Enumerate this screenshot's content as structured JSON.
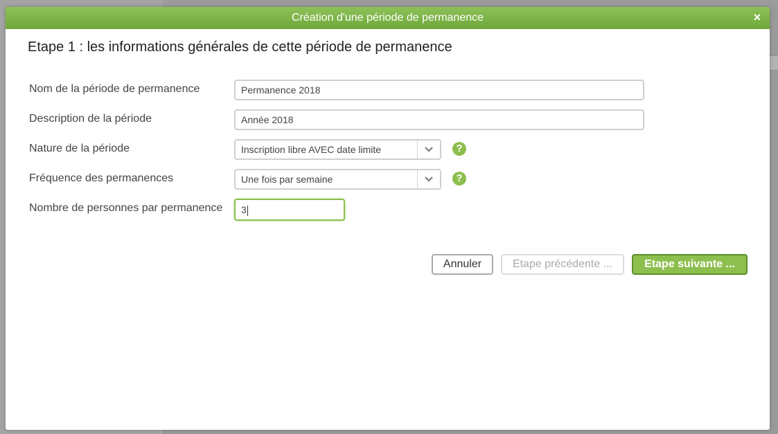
{
  "dialog": {
    "title": "Création d'une période de permanence",
    "close_glyph": "×",
    "step_title": "Etape 1 : les informations générales de cette période de permanence"
  },
  "form": {
    "name_label": "Nom de la période de permanence",
    "name_value": "Permanence 2018",
    "description_label": "Description de la période",
    "description_value": "Année 2018",
    "nature_label": "Nature de la période",
    "nature_selected": "Inscription libre AVEC date limite",
    "frequency_label": "Fréquence des permanences",
    "frequency_selected": "Une fois par semaine",
    "people_label": "Nombre de personnes par permanence",
    "people_value": "3",
    "help_glyph": "?"
  },
  "buttons": {
    "cancel": "Annuler",
    "previous": "Etape précédente ...",
    "next": "Etape suivante ..."
  },
  "colors": {
    "accent": "#8cbf4d",
    "titlebar": "#7bb547"
  },
  "icons": {
    "close": "close-icon",
    "dropdown": "chevron-down-icon",
    "help": "help-icon"
  }
}
